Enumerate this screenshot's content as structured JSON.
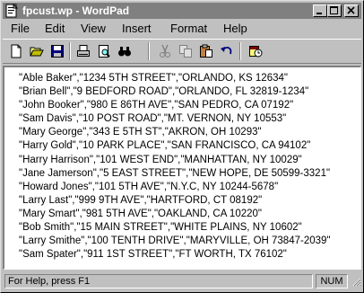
{
  "window": {
    "title": "fpcust.wp - WordPad",
    "app_icon": "wordpad-icon",
    "controls": [
      "minimize-icon",
      "maximize-icon",
      "close-icon"
    ]
  },
  "menu": {
    "items": [
      {
        "label": "File"
      },
      {
        "label": "Edit"
      },
      {
        "label": "View"
      },
      {
        "label": "Insert"
      },
      {
        "label": "Format"
      },
      {
        "label": "Help"
      }
    ]
  },
  "toolbar": {
    "tools": [
      "new-icon",
      "open-icon",
      "save-icon",
      "print-icon",
      "print-preview-icon",
      "find-icon",
      "cut-icon",
      "copy-icon",
      "paste-icon",
      "undo-icon",
      "date-time-icon"
    ]
  },
  "document": {
    "lines": [
      "\"Able Baker\",\"1234 5TH STREET\",\"ORLANDO, KS 12634\"",
      "\"Brian Bell\",\"9 BEDFORD ROAD\",\"ORLANDO, FL 32819-1234\"",
      "\"John Booker\",\"980 E 86TH AVE\",\"SAN PEDRO, CA 07192\"",
      "\"Sam Davis\",\"10 POST ROAD\",\"MT. VERNON, NY 10553\"",
      "\"Mary George\",\"343 E 5TH ST\",\"AKRON, OH 10293\"",
      "\"Harry Gold\",\"10 PARK PLACE\",\"SAN FRANCISCO, CA 94102\"",
      "\"Harry Harrison\",\"101 WEST END\",\"MANHATTAN, NY 10029\"",
      "\"Jane Jamerson\",\"5 EAST STREET\",\"NEW HOPE, DE 50599-3321\"",
      "\"Howard Jones\",\"101 5TH AVE\",\"N.Y.C, NY 10244-5678\"",
      "\"Larry Last\",\"999 9TH AVE\",\"HARTFORD, CT 08192\"",
      "\"Mary Smart\",\"981 5TH AVE\",\"OAKLAND, CA 10220\"",
      "\"Bob Smith\",\"15 MAIN STREET\",\"WHITE PLAINS, NY 10602\"",
      "\"Larry Smithe\",\"100 TENTH DRIVE\",\"MARYVILLE, OH 73847-2039\"",
      "\"Sam Spater\",\"911 1ST STREET\",\"FT WORTH, TX 76102\""
    ]
  },
  "statusbar": {
    "help_text": "For Help, press F1",
    "num_indicator": "NUM"
  },
  "colors": {
    "titlebar_inactive": "#808080",
    "face": "#c0c0c0",
    "document_bg": "#ffffff"
  }
}
